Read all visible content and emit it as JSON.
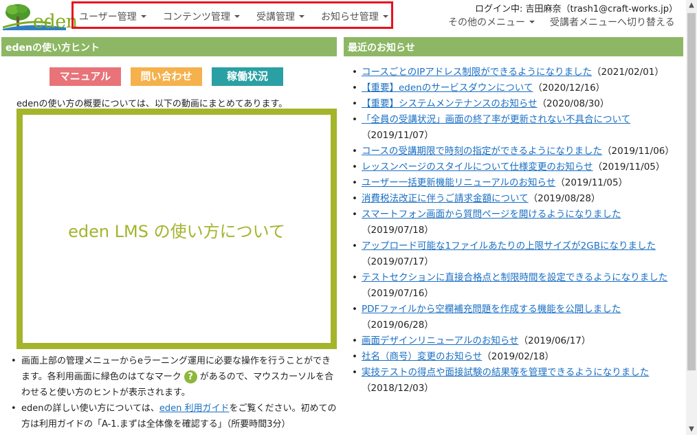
{
  "header": {
    "logo_text": "eden",
    "nav": [
      {
        "label": "ユーザー管理"
      },
      {
        "label": "コンテンツ管理"
      },
      {
        "label": "受講管理"
      },
      {
        "label": "お知らせ管理"
      }
    ],
    "login_info": "ログイン中: 吉田麻奈（trash1@craft-works.jp）",
    "other_menu": "その他のメニュー",
    "switch_menu": "受講者メニューへ切り替える"
  },
  "left_panel": {
    "title": "edenの使い方ヒント",
    "buttons": {
      "manual": "マニュアル",
      "contact": "問い合わせ",
      "status": "稼働状況"
    },
    "intro": "edenの使い方の概要については、以下の動画にまとめてあります。",
    "video_title": "eden LMS の使い方について",
    "bullet1_a": "画面上部の管理メニューからeラーニング運用に必要な操作を行うことができます。各利用画面に緑色のはてなマーク",
    "help_mark": "?",
    "bullet1_b": "があるので、マウスカーソルを合わせると使い方のヒントが表示されます。",
    "bullet2_a": "edenの詳しい使い方については、",
    "bullet2_link": "eden 利用ガイド",
    "bullet2_b": "をご覧ください。初めての方は利用ガイドの「A-1.まずは全体像を確認する」（所要時間3分）"
  },
  "right_panel": {
    "title": "最近のお知らせ",
    "news": [
      {
        "title": "コースごとのIPアドレス制限ができるようになりました",
        "date": "（2021/02/01）"
      },
      {
        "title": "【重要】edenのサービスダウンについて",
        "date": "（2020/12/16）"
      },
      {
        "title": "【重要】システムメンテナンスのお知らせ",
        "date": "（2020/08/30）"
      },
      {
        "title": "「全員の受講状況」画面の終了率が更新されない不具合について",
        "date": "（2019/11/07）"
      },
      {
        "title": "コースの受講期限で時刻の指定ができるようになりました",
        "date": "（2019/11/06）"
      },
      {
        "title": "レッスンページのスタイルについて仕様変更のお知らせ",
        "date": "（2019/11/05）"
      },
      {
        "title": "ユーザー一括更新機能リニューアルのお知らせ",
        "date": "（2019/11/05）"
      },
      {
        "title": "消費税法改正に伴うご請求金額について",
        "date": "（2019/08/28）"
      },
      {
        "title": "スマートフォン画面から質問ページを開けるようになりました",
        "date": "（2019/07/18）"
      },
      {
        "title": "アップロード可能な1ファイルあたりの上限サイズが2GBになりました",
        "date": "（2019/07/17）"
      },
      {
        "title": "テストセクションに直接合格点と制限時間を設定できるようになりました",
        "date": "（2019/07/16）"
      },
      {
        "title": "PDFファイルから空欄補充問題を作成する機能を公開しました",
        "date": "（2019/06/28）"
      },
      {
        "title": "画面デザインリニューアルのお知らせ",
        "date": "（2019/06/17）"
      },
      {
        "title": "社名（商号）変更のお知らせ",
        "date": "（2019/02/18）"
      },
      {
        "title": "実技テストの得点や面接試験の結果等を管理できるようになりました",
        "date": "（2018/12/03）"
      }
    ]
  },
  "colors": {
    "panel_header": "#8db764",
    "nav_highlight": "#e8101c",
    "video_border": "#a4b42b",
    "link": "#1a6fc4"
  }
}
